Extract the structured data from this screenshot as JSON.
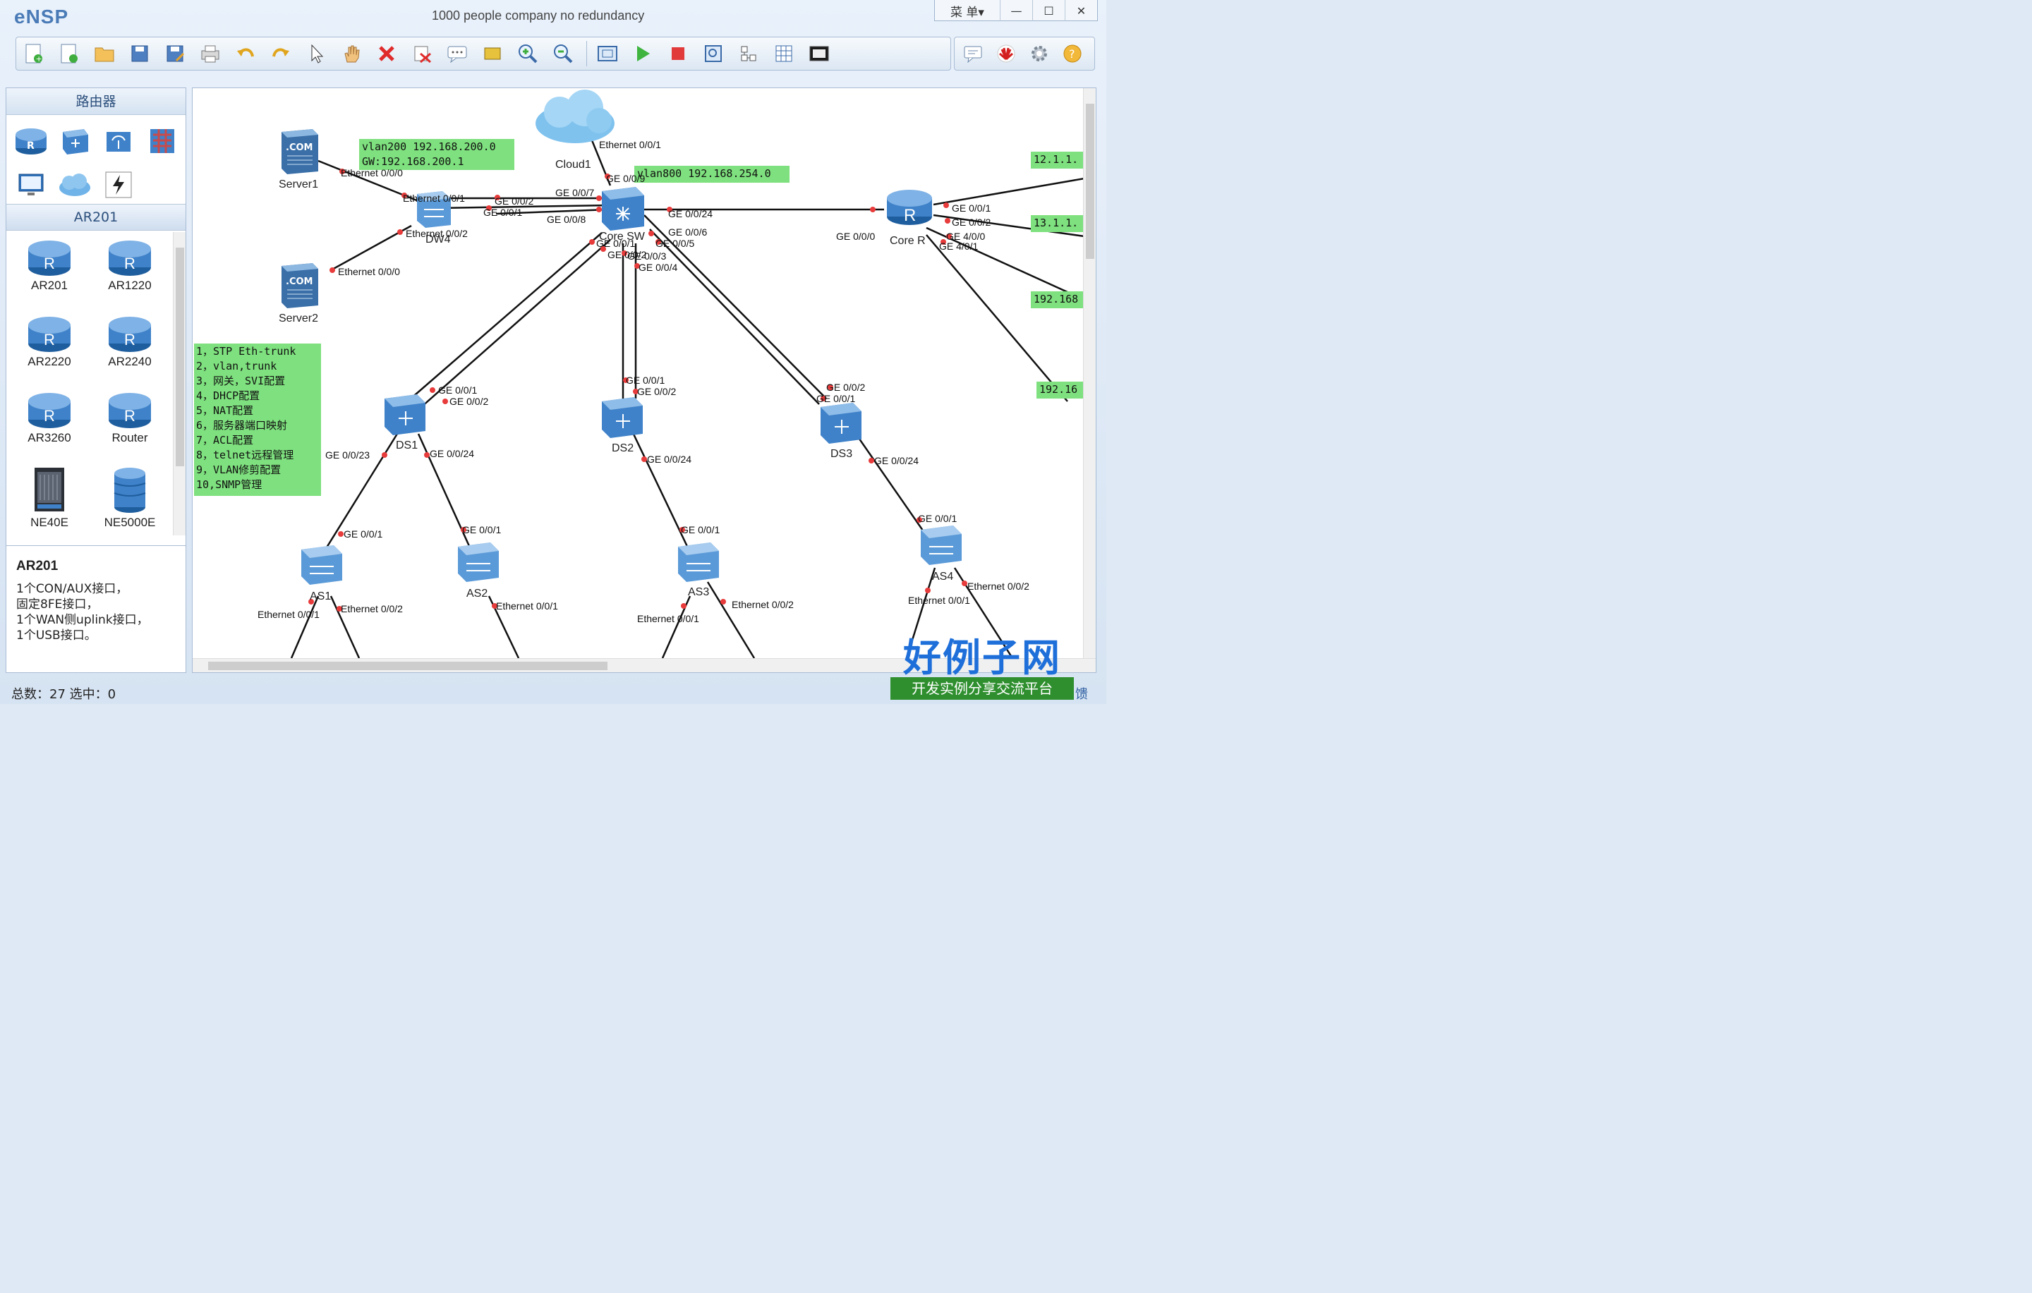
{
  "app": {
    "logo": "eNSP",
    "title": "1000 people company no redundancy"
  },
  "window": {
    "menu": "菜 单▾",
    "minimize": "—",
    "maximize": "☐",
    "close": "✕"
  },
  "left_panel": {
    "category_title": "路由器",
    "subcategory_title": "AR201",
    "devices": [
      "AR201",
      "AR1220",
      "AR2220",
      "AR2240",
      "AR3260",
      "Router",
      "NE40E",
      "NE5000E"
    ],
    "description_title": "AR201",
    "description_lines": [
      "1个CON/AUX接口，",
      "固定8FE接口，",
      "1个WAN侧uplink接口，",
      "1个USB接口。"
    ]
  },
  "notes": {
    "vlan200": [
      "vlan200 192.168.200.0",
      "GW:192.168.200.1"
    ],
    "vlan800": "vlan800 192.168.254.0",
    "tasks": [
      "1，STP Eth-trunk",
      "2，vlan,trunk",
      "3，网关，SVI配置",
      "4，DHCP配置",
      "5，NAT配置",
      "6，服务器端口映射",
      "7，ACL配置",
      "8，telnet远程管理",
      "9，VLAN修剪配置",
      "10,SNMP管理"
    ],
    "right": [
      "12.1.1.",
      "13.1.1.",
      "192.168",
      "192.16"
    ]
  },
  "devices_on_canvas": {
    "server1": "Server1",
    "server2": "Server2",
    "cloud1": "Cloud1",
    "dw4": "DW4",
    "core_sw": "Core SW",
    "core_r": "Core R",
    "ds1": "DS1",
    "ds2": "DS2",
    "ds3": "DS3",
    "as1": "AS1",
    "as2": "AS2",
    "as3": "AS3",
    "as4": "AS4"
  },
  "port_labels": {
    "server1_eth": "Ethernet 0/0/0",
    "server2_eth": "Ethernet 0/0/0",
    "dw4_e1": "Ethernet 0/0/1",
    "dw4_e2": "Ethernet 0/0/2",
    "dw4_g2": "GE 0/0/2",
    "dw4_g1": "GE 0/0/1",
    "cloud_eth": "Ethernet 0/0/1",
    "csw_g9": "GE 0/0/9",
    "csw_g7": "GE 0/0/7",
    "csw_g8": "GE 0/0/8",
    "csw_g24": "GE 0/0/24",
    "csw_g6": "GE 0/0/6",
    "csw_g5": "GE 0/0/5",
    "csw_g1": "GE 0/0/1",
    "csw_g2": "GE 0/0/2",
    "csw_g3": "GE 0/0/3",
    "csw_g4": "GE 0/0/4",
    "cr_g0": "GE 0/0/0",
    "cr_g1": "GE 0/0/1",
    "cr_g2": "GE 0/0/2",
    "cr_g40": "GE 4/0/0",
    "cr_g41": "GE 4/0/1",
    "ds1_g1": "GE 0/0/1",
    "ds1_g2": "GE 0/0/2",
    "ds1_g23": "GE 0/0/23",
    "ds1_g24": "GE 0/0/24",
    "ds2_g1": "GE 0/0/1",
    "ds2_g2": "GE 0/0/2",
    "ds2_g24": "GE 0/0/24",
    "ds3_g2": "GE 0/0/2",
    "ds3_g1": "GE 0/0/1",
    "ds3_g24": "GE 0/0/24",
    "as1_g1": "GE 0/0/1",
    "as1_e1": "Ethernet 0/0/1",
    "as1_e2": "Ethernet 0/0/2",
    "as2_g1": "GE 0/0/1",
    "as2_e1": "Ethernet 0/0/1",
    "as3_g1": "GE 0/0/1",
    "as3_e1": "Ethernet 0/0/1",
    "as3_e2": "Ethernet 0/0/2",
    "as4_g1": "GE 0/0/1",
    "as4_e2": "Ethernet 0/0/2",
    "as4_e1": "Ethernet 0/0/1"
  },
  "status": {
    "text": "总数：27  选中：0",
    "right": "馈"
  },
  "brand": {
    "name": "好例子网",
    "tagline": "开发实例分享交流平台"
  },
  "colors": {
    "note_bg": "#7ee07e",
    "port_dot": "#e83b3b",
    "device_blue": "#3f82c9"
  }
}
